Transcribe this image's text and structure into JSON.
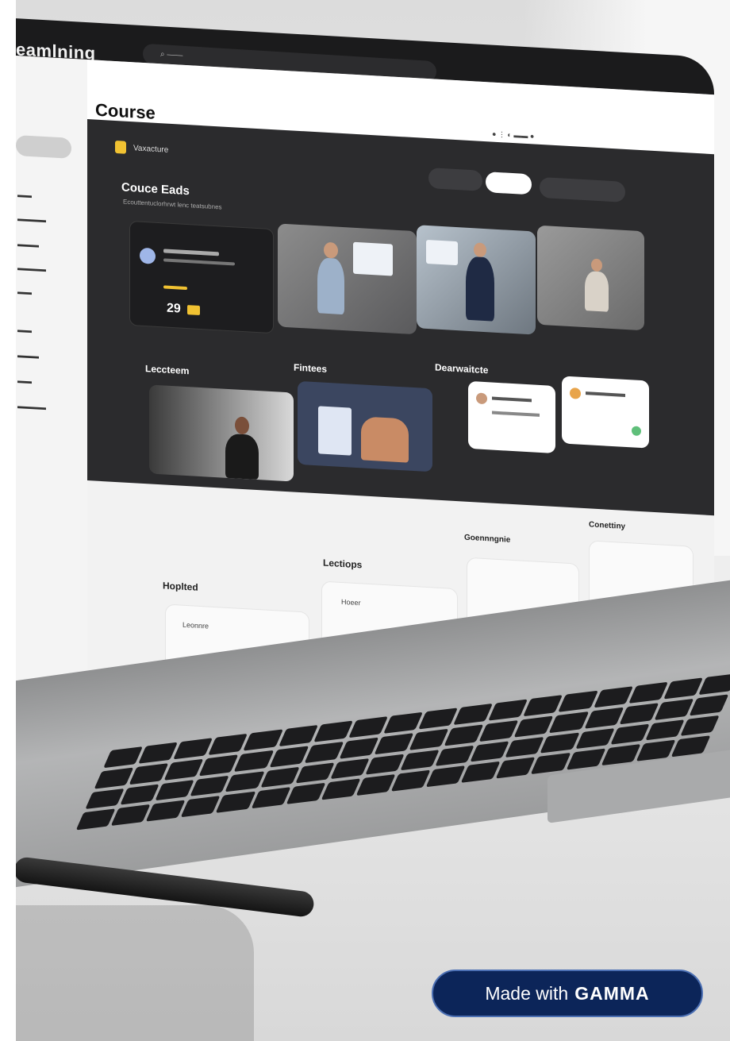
{
  "photo": {
    "brand_text": "eamlning",
    "screen": {
      "page_title": "Course",
      "dark_section": {
        "brand_chip_label": "Vaxacture",
        "cards_title": "Couce Eads",
        "cards_subtitle": "Ecouttentuclorhrwt lenc teatsubnes",
        "featured_price": "29",
        "lectures_title": "Leccteem",
        "feature_title": "Fintees",
        "discussion_title": "Dearwaitcte"
      },
      "lower_section": {
        "panel1_title": "Hoplted",
        "panel1_item": "Leonnre",
        "panel2_title": "Lectiops",
        "panel2_item": "Hoeer",
        "panel3_title": "Goennngnie",
        "panel4_title": "Conettiny"
      }
    }
  },
  "badge": {
    "prefix": "Made with",
    "brand": "GAMMA"
  },
  "colors": {
    "badge_bg": "#0c2559",
    "dark_panel": "#2b2b2d",
    "accent_yellow": "#f1c232"
  }
}
